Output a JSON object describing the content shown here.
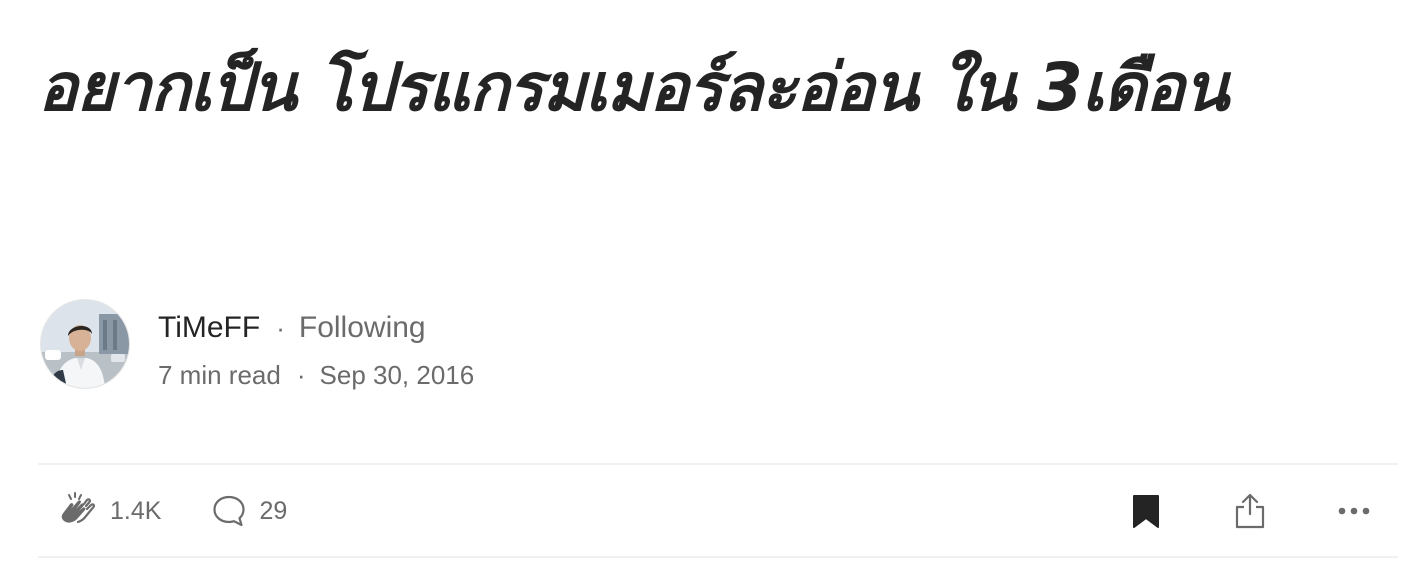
{
  "article": {
    "title": "อยากเป็น โปรแกรมเมอร์ละอ่อน ใน 3เดือน"
  },
  "author": {
    "name": "TiMeFF",
    "separator": "·",
    "follow_status": "Following",
    "avatar_icon": "author-photo"
  },
  "meta": {
    "read_time": "7 min read",
    "separator": "·",
    "published": "Sep 30, 2016"
  },
  "actions": {
    "claps": "1.4K",
    "comments": "29",
    "icons": [
      "clap-icon",
      "comment-icon",
      "bookmark-icon",
      "share-icon",
      "more-icon"
    ]
  },
  "colors": {
    "text_primary": "#242424",
    "text_secondary": "#6b6b6b",
    "divider": "#f0f0f0"
  }
}
